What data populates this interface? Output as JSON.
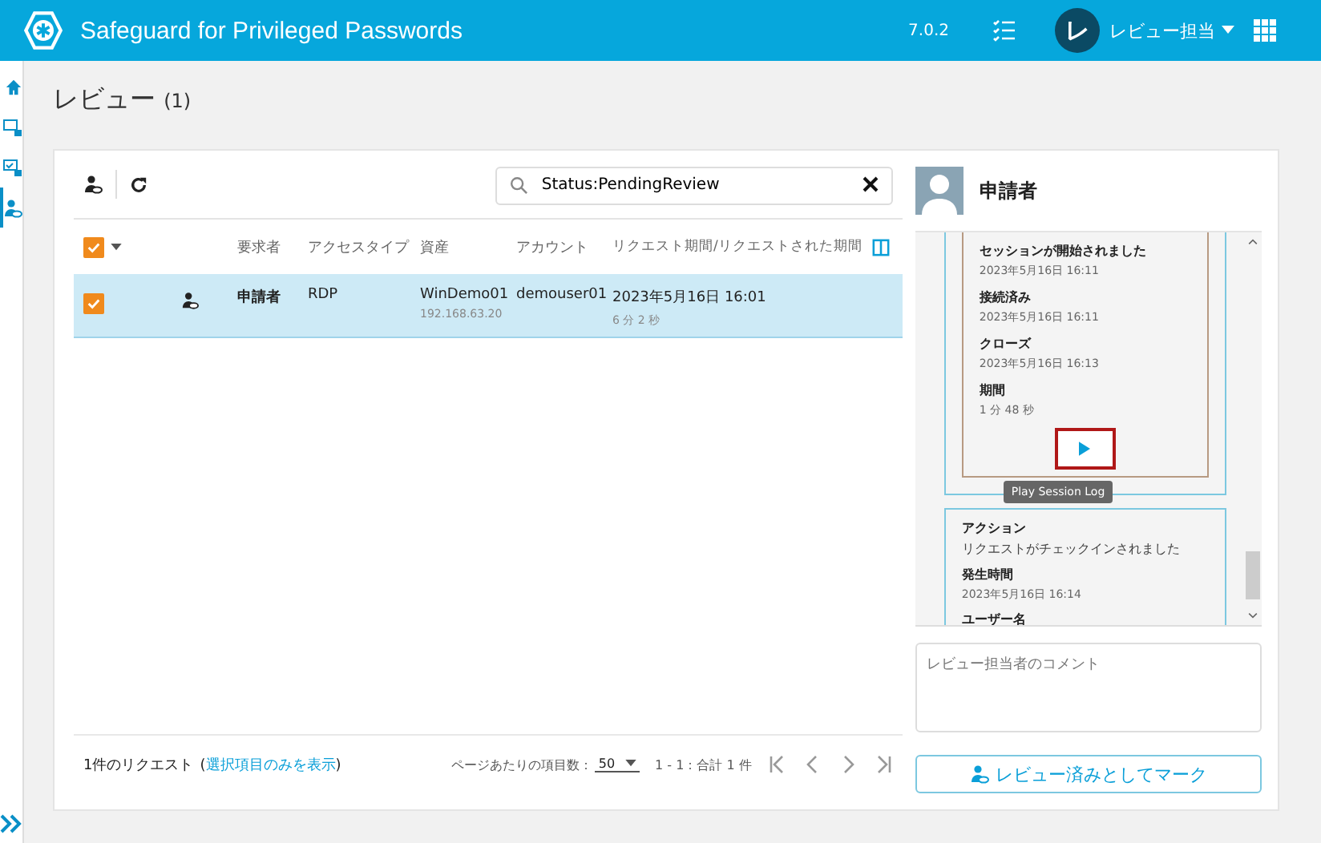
{
  "header": {
    "title": "Safeguard for Privileged Passwords",
    "version": "7.0.2",
    "user_initial": "レ",
    "user_name": "レビュー担当"
  },
  "sidebar": {
    "items": [
      {
        "selected": false
      },
      {
        "selected": false
      },
      {
        "selected": false
      },
      {
        "selected": true
      }
    ]
  },
  "page_title": {
    "text": "レビュー",
    "count": "(1)"
  },
  "search": {
    "value": "Status:PendingReview"
  },
  "table": {
    "select_all": {
      "checked": true
    },
    "columns": [
      "要求者",
      "アクセスタイプ",
      "資産",
      "アカウント",
      "リクエスト期間/リクエストされた期間"
    ],
    "rows": [
      {
        "checked": true,
        "selected": true,
        "requester": "申請者",
        "access_type": "RDP",
        "asset": "WinDemo01",
        "asset_ip": "192.168.63.20",
        "account": "demouser01",
        "requested": "2023年5月16日 16:01",
        "duration": "6 分 2 秒"
      }
    ]
  },
  "footer": {
    "count": "1件のリクエスト",
    "link_open": "(",
    "link": "選択項目のみを表示",
    "link_close": ")",
    "per_page_label": "ページあたりの項目数：",
    "per_page": "50",
    "range": "1 - 1：合計 1 件"
  },
  "detail": {
    "name": "申請者",
    "session_events": [
      {
        "label": "セッションが開始されました",
        "value": "2023年5月16日 16:11"
      },
      {
        "label": "接続済み",
        "value": "2023年5月16日 16:11"
      },
      {
        "label": "クローズ",
        "value": "2023年5月16日 16:13"
      },
      {
        "label": "期間",
        "value": "1 分 48 秒"
      }
    ],
    "play_tooltip": "Play Session Log",
    "activity": [
      {
        "label": "アクション",
        "value": "リクエストがチェックインされました"
      },
      {
        "label": "発生時間",
        "value": "2023年5月16日 16:14"
      },
      {
        "label": "ユーザー名"
      }
    ],
    "comment_placeholder": "レビュー担当者のコメント",
    "mark_button": "レビュー済みとしてマーク"
  }
}
